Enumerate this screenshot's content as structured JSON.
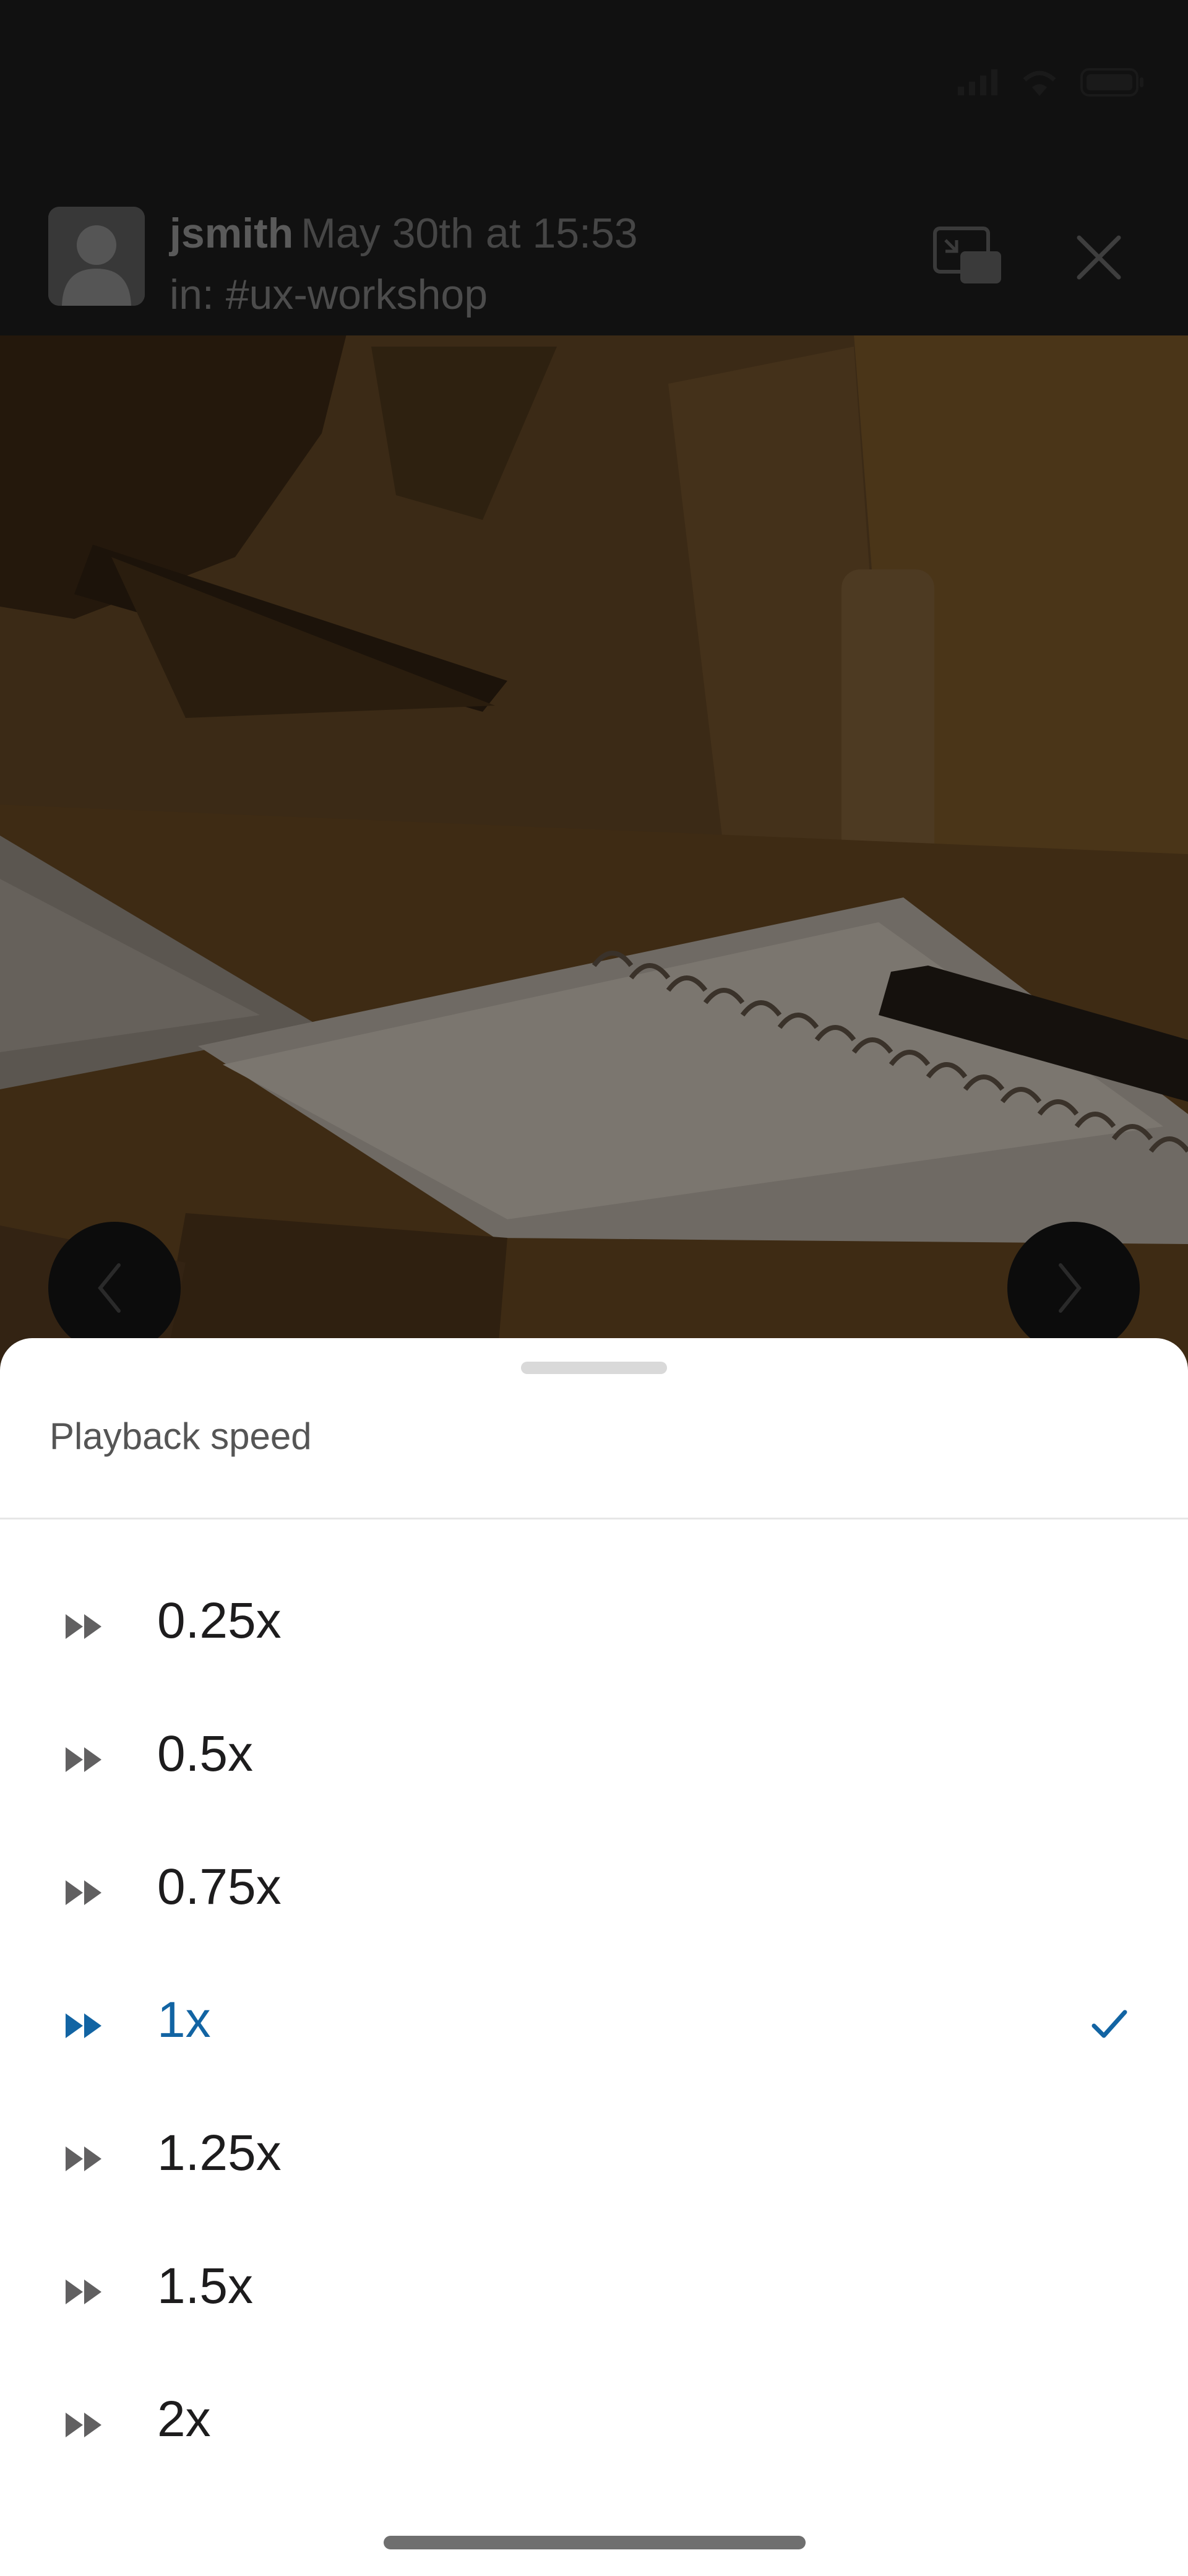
{
  "header": {
    "username": "jsmith",
    "timestamp": "May 30th at 15:53",
    "channel": "in: #ux-workshop",
    "pip_icon": "picture-in-picture-icon",
    "close_icon": "close-icon"
  },
  "navigation": {
    "prev_icon": "chevron-left-icon",
    "next_icon": "chevron-right-icon"
  },
  "sheet": {
    "title": "Playback speed",
    "options": [
      {
        "label": "0.25x",
        "selected": false
      },
      {
        "label": "0.5x",
        "selected": false
      },
      {
        "label": "0.75x",
        "selected": false
      },
      {
        "label": "1x",
        "selected": true
      },
      {
        "label": "1.25x",
        "selected": false
      },
      {
        "label": "1.5x",
        "selected": false
      },
      {
        "label": "2x",
        "selected": false
      }
    ],
    "option_icon": "fast-forward-icon",
    "selected_icon": "checkmark-icon"
  },
  "colors": {
    "accent": "#1264a3",
    "text": "#1d1c1d",
    "overlay": "#111111",
    "sheet_bg": "#ffffff"
  }
}
